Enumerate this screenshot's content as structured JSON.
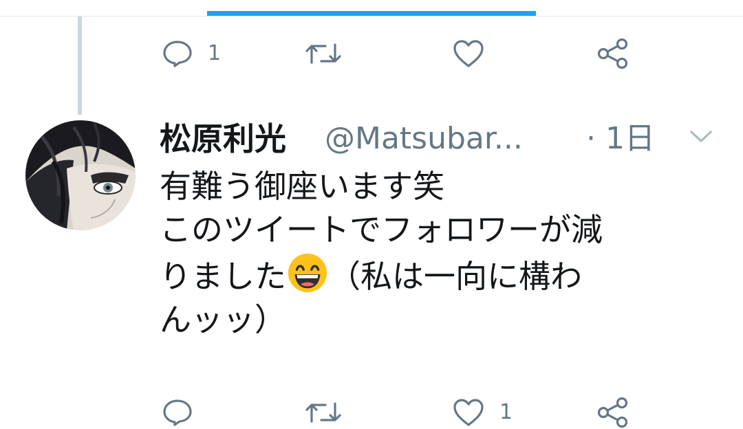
{
  "tweet": {
    "display_name": "松原利光",
    "handle": "@Matsubar...",
    "timestamp": "· 1日",
    "text_lines": [
      "有難う御座います笑",
      "このツイートでフォロワーが減",
      "りました",
      "（私は一向に構わ",
      "んッッ）"
    ]
  },
  "top_actions": {
    "reply_count": "1",
    "retweet_count": "",
    "like_count": ""
  },
  "bottom_actions": {
    "reply_count": "",
    "retweet_count": "",
    "like_count": "1"
  },
  "icons": {
    "reply": "reply-icon",
    "retweet": "retweet-icon",
    "like": "heart-icon",
    "share": "share-icon",
    "caret": "chevron-down-icon",
    "emoji": "grinning-face-emoji"
  },
  "colors": {
    "accent": "#1da1f2",
    "icon_gray": "#657786",
    "text": "#14171a",
    "thread_line": "#ccd6dd"
  }
}
